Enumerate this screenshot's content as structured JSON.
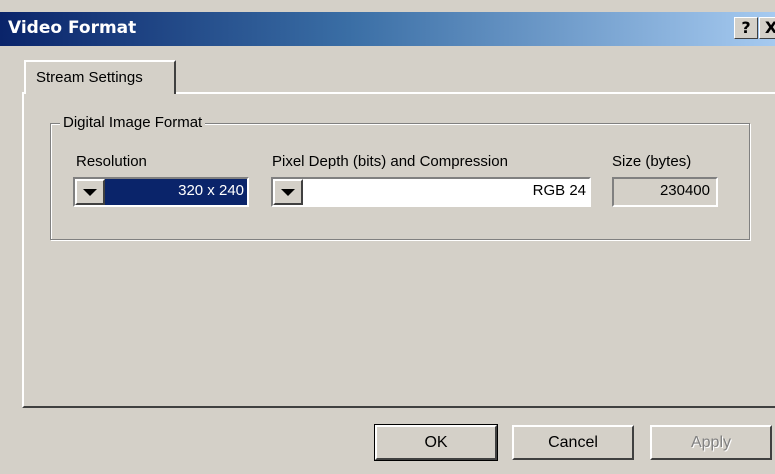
{
  "window": {
    "title": "Video Format",
    "help_label": "?",
    "close_label": "X"
  },
  "tabs": [
    {
      "label": "Stream Settings",
      "selected": true
    }
  ],
  "group": {
    "label": "Digital Image Format",
    "resolution": {
      "label": "Resolution",
      "value": "320 x 240"
    },
    "depth": {
      "label": "Pixel Depth (bits) and Compression",
      "value": "RGB 24"
    },
    "size": {
      "label": "Size (bytes)",
      "value": "230400"
    }
  },
  "buttons": {
    "ok": "OK",
    "cancel": "Cancel",
    "apply": "Apply"
  },
  "colors": {
    "title_gradient_start": "#0a246a",
    "title_gradient_end": "#a6caf0",
    "face": "#d4d0c8",
    "selection": "#0a246a"
  }
}
